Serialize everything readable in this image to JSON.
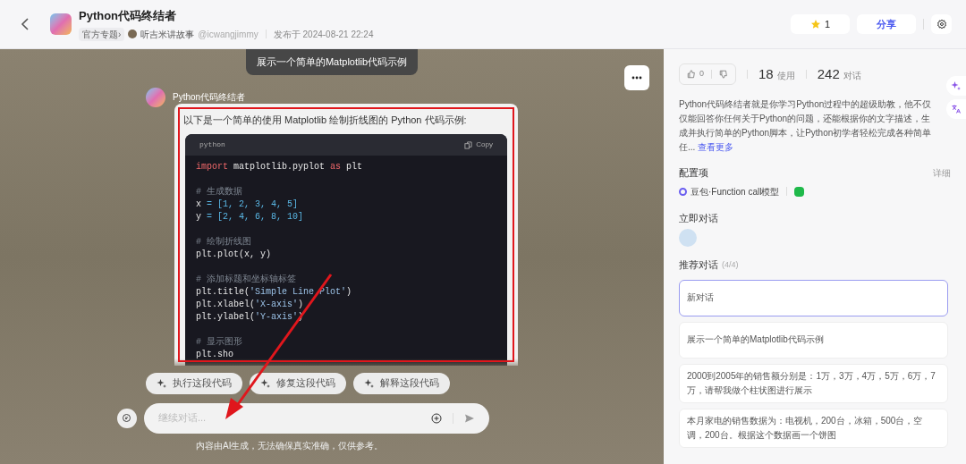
{
  "header": {
    "title": "Python代码终结者",
    "tag": "官方专题›",
    "author": "听吉米讲故事",
    "handle": "@icwangjimmy",
    "published": "发布于 2024-08-21 22:24",
    "favorite_count": "1",
    "share": "分享"
  },
  "chat": {
    "user_message": "展示一个简单的Matplotlib代码示例",
    "bot_name": "Python代码终结者",
    "intro": "以下是一个简单的使用 Matplotlib 绘制折线图的 Python 代码示例:",
    "code": {
      "language": "python",
      "copy": "Copy",
      "blocks": [
        [
          [
            {
              "kind": "keyword",
              "text": "import"
            },
            {
              "kind": "plain",
              "text": " matplotlib.pyplot "
            },
            {
              "kind": "keyword",
              "text": "as"
            },
            {
              "kind": "plain",
              "text": " plt"
            }
          ]
        ],
        [
          [
            {
              "kind": "comment",
              "text": "# 生成数据"
            }
          ],
          [
            {
              "kind": "plain",
              "text": "x "
            },
            {
              "kind": "number",
              "text": "= [1, 2, 3, 4, 5]"
            }
          ],
          [
            {
              "kind": "plain",
              "text": "y "
            },
            {
              "kind": "number",
              "text": "= [2, 4, 6, 8, 10]"
            }
          ]
        ],
        [
          [
            {
              "kind": "comment",
              "text": "# 绘制折线图"
            }
          ],
          [
            {
              "kind": "plain",
              "text": "plt.plot(x, y)"
            }
          ]
        ],
        [
          [
            {
              "kind": "comment",
              "text": "# 添加标题和坐标轴标签"
            }
          ],
          [
            {
              "kind": "plain",
              "text": "plt.title("
            },
            {
              "kind": "string",
              "text": "'Simple Line Plot'"
            },
            {
              "kind": "plain",
              "text": ")"
            }
          ],
          [
            {
              "kind": "plain",
              "text": "plt.xlabel("
            },
            {
              "kind": "string",
              "text": "'X-axis'"
            },
            {
              "kind": "plain",
              "text": ")"
            }
          ],
          [
            {
              "kind": "plain",
              "text": "plt.ylabel("
            },
            {
              "kind": "string",
              "text": "'Y-axis'"
            },
            {
              "kind": "plain",
              "text": ")"
            }
          ]
        ],
        [
          [
            {
              "kind": "comment",
              "text": "# 显示图形"
            }
          ],
          [
            {
              "kind": "plain",
              "text": "plt.sho"
            }
          ]
        ]
      ]
    },
    "suggestions": [
      "执行这段代码",
      "修复这段代码",
      "解释这段代码"
    ],
    "input": {
      "placeholder": "继续对话..."
    },
    "disclaimer": "内容由AI生成，无法确保真实准确，仅供参考。"
  },
  "sidebar": {
    "likes": "0",
    "uses": "18",
    "uses_label": "使用",
    "chats": "242",
    "chats_label": "对话",
    "description": "Python代码终结者就是你学习Python过程中的超级助教，他不仅仅能回答你任何关于Python的问题，还能根据你的文字描述，生成并执行简单的Python脚本，让Python初学者轻松完成各种简单任...",
    "more": "查看更多",
    "config_title": "配置项",
    "config_detail": "详细",
    "model": "豆包·Function call模型",
    "chat_now": "立即对话",
    "recommended_title": "推荐对话",
    "recommended_count": "(4/4)",
    "recommended": [
      {
        "text": "新对话",
        "selected": true
      },
      {
        "text": "展示一个简单的Matplotlib代码示例",
        "selected": false
      },
      {
        "text": "2000到2005年的销售额分别是：1万，3万，4万，5万，6万，7万，请帮我做个柱状图进行展示",
        "selected": false
      },
      {
        "text": "本月家电的销售数据为：电视机，200台，冰箱，500台，空调，200台。根据这个数据画一个饼图",
        "selected": false
      }
    ]
  }
}
